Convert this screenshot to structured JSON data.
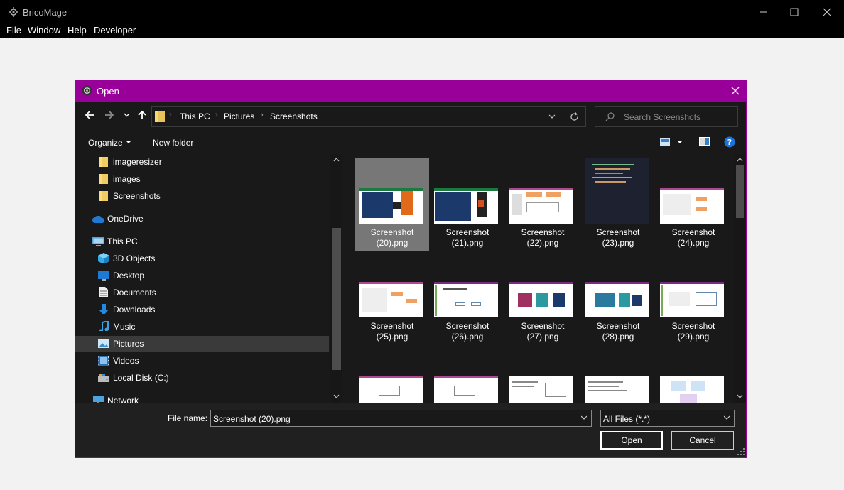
{
  "app": {
    "title": "BricoMage",
    "menu": [
      "File",
      "Window",
      "Help",
      "Developer"
    ]
  },
  "dialog": {
    "title": "Open",
    "breadcrumb": [
      "This PC",
      "Pictures",
      "Screenshots"
    ],
    "search_placeholder": "Search Screenshots",
    "toolbar": {
      "organize": "Organize",
      "new_folder": "New folder"
    },
    "sidebar": [
      {
        "label": "imageresizer",
        "icon": "folder-icon"
      },
      {
        "label": "images",
        "icon": "folder-icon"
      },
      {
        "label": "Screenshots",
        "icon": "folder-icon"
      },
      {
        "label": "OneDrive",
        "icon": "cloud-icon"
      },
      {
        "label": "This PC",
        "icon": "computer-icon"
      },
      {
        "label": "3D Objects",
        "icon": "cube-icon"
      },
      {
        "label": "Desktop",
        "icon": "desktop-icon"
      },
      {
        "label": "Documents",
        "icon": "document-icon"
      },
      {
        "label": "Downloads",
        "icon": "download-icon"
      },
      {
        "label": "Music",
        "icon": "music-icon"
      },
      {
        "label": "Pictures",
        "icon": "pictures-icon"
      },
      {
        "label": "Videos",
        "icon": "video-icon"
      },
      {
        "label": "Local Disk (C:)",
        "icon": "drive-icon"
      },
      {
        "label": "Network",
        "icon": "network-icon"
      }
    ],
    "files": [
      {
        "line1": "Screenshot",
        "line2": "(20).png"
      },
      {
        "line1": "Screenshot",
        "line2": "(21).png"
      },
      {
        "line1": "Screenshot",
        "line2": "(22).png"
      },
      {
        "line1": "Screenshot",
        "line2": "(23).png"
      },
      {
        "line1": "Screenshot",
        "line2": "(24).png"
      },
      {
        "line1": "Screenshot",
        "line2": "(25).png"
      },
      {
        "line1": "Screenshot",
        "line2": "(26).png"
      },
      {
        "line1": "Screenshot",
        "line2": "(27).png"
      },
      {
        "line1": "Screenshot",
        "line2": "(28).png"
      },
      {
        "line1": "Screenshot",
        "line2": "(29).png"
      }
    ],
    "file_name_label": "File name:",
    "file_name_value": "Screenshot (20).png",
    "file_type": "All Files (*.*)",
    "open_label": "Open",
    "cancel_label": "Cancel"
  }
}
